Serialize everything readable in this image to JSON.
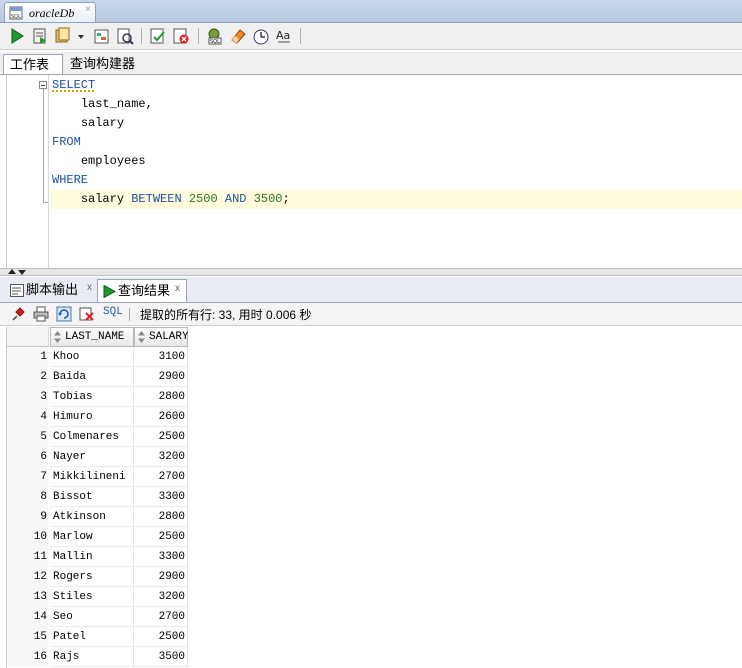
{
  "doc_tab": {
    "title": "oracleDb",
    "close": "×",
    "icon": "sql-file-icon"
  },
  "toolbar": {
    "buttons": [
      "run-statement-icon",
      "run-script-icon",
      "commit-icon",
      "dropdown-arrow-icon",
      "explain-plan-icon",
      "autotrace-icon",
      "commit-transaction-icon",
      "rollback-icon",
      "sql-tuning-icon",
      "clear-eraser-icon",
      "history-icon",
      "uppercase-format-icon"
    ]
  },
  "editor_tabs": {
    "worksheet": "工作表",
    "query_builder": "查询构建器"
  },
  "editor": {
    "lines": [
      {
        "indent": "",
        "tokens": [
          {
            "t": "SELECT",
            "k": "kw"
          }
        ]
      },
      {
        "indent": "    ",
        "tokens": [
          {
            "t": "last_name,",
            "k": "id"
          }
        ]
      },
      {
        "indent": "    ",
        "tokens": [
          {
            "t": "salary",
            "k": "id"
          }
        ]
      },
      {
        "indent": "",
        "tokens": [
          {
            "t": "FROM",
            "k": "kw"
          }
        ]
      },
      {
        "indent": "    ",
        "tokens": [
          {
            "t": "employees",
            "k": "id"
          }
        ]
      },
      {
        "indent": "",
        "tokens": [
          {
            "t": "WHERE",
            "k": "kw"
          }
        ]
      },
      {
        "indent": "    ",
        "tokens": [
          {
            "t": "salary ",
            "k": "id"
          },
          {
            "t": "BETWEEN",
            "k": "kw"
          },
          {
            "t": " ",
            "k": "id"
          },
          {
            "t": "2500",
            "k": "num"
          },
          {
            "t": " ",
            "k": "id"
          },
          {
            "t": "AND",
            "k": "kw"
          },
          {
            "t": " ",
            "k": "id"
          },
          {
            "t": "3500",
            "k": "num"
          },
          {
            "t": ";",
            "k": "id"
          }
        ]
      }
    ]
  },
  "result_tabs": {
    "script_output": "脚本输出",
    "query_result": "查询结果",
    "close": "x"
  },
  "result_toolbar": {
    "sql_label": "SQL",
    "fetch_status": "提取的所有行: 33, 用时 0.006 秒"
  },
  "grid": {
    "columns": [
      "LAST_NAME",
      "SALARY"
    ],
    "rows": [
      {
        "n": "1",
        "last_name": "Khoo",
        "salary": "3100"
      },
      {
        "n": "2",
        "last_name": "Baida",
        "salary": "2900"
      },
      {
        "n": "3",
        "last_name": "Tobias",
        "salary": "2800"
      },
      {
        "n": "4",
        "last_name": "Himuro",
        "salary": "2600"
      },
      {
        "n": "5",
        "last_name": "Colmenares",
        "salary": "2500"
      },
      {
        "n": "6",
        "last_name": "Nayer",
        "salary": "3200"
      },
      {
        "n": "7",
        "last_name": "Mikkilineni",
        "salary": "2700"
      },
      {
        "n": "8",
        "last_name": "Bissot",
        "salary": "3300"
      },
      {
        "n": "9",
        "last_name": "Atkinson",
        "salary": "2800"
      },
      {
        "n": "10",
        "last_name": "Marlow",
        "salary": "2500"
      },
      {
        "n": "11",
        "last_name": "Mallin",
        "salary": "3300"
      },
      {
        "n": "12",
        "last_name": "Rogers",
        "salary": "2900"
      },
      {
        "n": "13",
        "last_name": "Stiles",
        "salary": "3200"
      },
      {
        "n": "14",
        "last_name": "Seo",
        "salary": "2700"
      },
      {
        "n": "15",
        "last_name": "Patel",
        "salary": "2500"
      },
      {
        "n": "16",
        "last_name": "Rajs",
        "salary": "3500"
      }
    ]
  }
}
